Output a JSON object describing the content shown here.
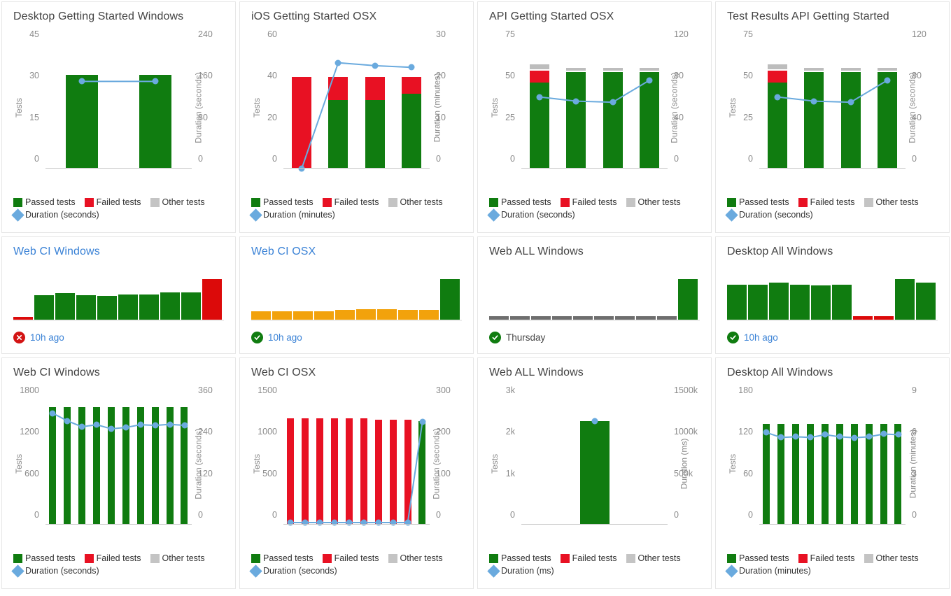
{
  "legend": {
    "passed_label": "Passed tests",
    "failed_label": "Failed tests",
    "other_label": "Other tests"
  },
  "colors": {
    "passed": "#107c10",
    "failed": "#e81123",
    "other": "#bdbdbd",
    "duration_line": "#6aaade",
    "link": "#3a82d6",
    "spark_other": "#f2a20c",
    "spark_skipped": "#6e6e6e"
  },
  "cards": [
    {
      "id": "desktop-getting-started-windows",
      "kind": "chart",
      "title": "Desktop Getting Started Windows",
      "title_is_link": false,
      "chart_data": {
        "type": "bar",
        "title": "Desktop Getting Started Windows",
        "ylabel": "Tests",
        "y2label": "Duration (seconds)",
        "yticks": [
          "0",
          "15",
          "30",
          "45"
        ],
        "y2ticks": [
          "0",
          "80",
          "160",
          "240"
        ],
        "ylim": [
          0,
          45
        ],
        "y2lim": [
          0,
          240
        ],
        "grid": false,
        "legend_position": "bottom",
        "duration_label": "Duration (seconds)",
        "categories": [
          "1",
          "2"
        ],
        "series": [
          {
            "name": "Passed tests",
            "values": [
              34,
              34
            ]
          },
          {
            "name": "Failed tests",
            "values": [
              0,
              0
            ]
          },
          {
            "name": "Other tests",
            "values": [
              0,
              0
            ]
          }
        ],
        "duration": [
          168,
          168
        ]
      }
    },
    {
      "id": "ios-getting-started-osx",
      "kind": "chart",
      "title": "iOS Getting Started OSX",
      "title_is_link": false,
      "chart_data": {
        "type": "bar",
        "title": "iOS Getting Started OSX",
        "ylabel": "Tests",
        "y2label": "Duration (minutes)",
        "yticks": [
          "0",
          "20",
          "40",
          "60"
        ],
        "y2ticks": [
          "0",
          "10",
          "20",
          "30"
        ],
        "ylim": [
          0,
          60
        ],
        "y2lim": [
          0,
          30
        ],
        "grid": false,
        "legend_position": "bottom",
        "duration_label": "Duration (minutes)",
        "categories": [
          "1",
          "2",
          "3",
          "4"
        ],
        "series": [
          {
            "name": "Passed tests",
            "values": [
              0,
              33,
              33,
              36
            ]
          },
          {
            "name": "Failed tests",
            "values": [
              44,
              11,
              11,
              8
            ]
          },
          {
            "name": "Other tests",
            "values": [
              0,
              0,
              0,
              0
            ]
          }
        ],
        "duration": [
          0,
          25.5,
          24.8,
          24.4
        ]
      }
    },
    {
      "id": "api-getting-started-osx",
      "kind": "chart",
      "title": "API Getting Started OSX",
      "title_is_link": false,
      "chart_data": {
        "type": "bar",
        "title": "API Getting Started OSX",
        "ylabel": "Tests",
        "y2label": "Duration (seconds)",
        "yticks": [
          "0",
          "25",
          "50",
          "75"
        ],
        "y2ticks": [
          "0",
          "40",
          "80",
          "120"
        ],
        "ylim": [
          0,
          75
        ],
        "y2lim": [
          0,
          120
        ],
        "grid": false,
        "legend_position": "bottom",
        "duration_label": "Duration (seconds)",
        "categories": [
          "1",
          "2",
          "3",
          "4"
        ],
        "series": [
          {
            "name": "Passed tests",
            "values": [
              52,
              58,
              58,
              58
            ]
          },
          {
            "name": "Failed tests",
            "values": [
              7,
              0,
              0,
              0
            ]
          },
          {
            "name": "Other tests",
            "values": [
              3,
              2,
              2,
              2
            ]
          }
        ],
        "duration": [
          69,
          65,
          64,
          85
        ]
      }
    },
    {
      "id": "test-results-api-getting-started",
      "kind": "chart",
      "title": "Test Results API Getting Started",
      "title_is_link": false,
      "chart_data": {
        "type": "bar",
        "title": "Test Results API Getting Started",
        "ylabel": "Tests",
        "y2label": "Duration (seconds)",
        "yticks": [
          "0",
          "25",
          "50",
          "75"
        ],
        "y2ticks": [
          "0",
          "40",
          "80",
          "120"
        ],
        "ylim": [
          0,
          75
        ],
        "y2lim": [
          0,
          120
        ],
        "grid": false,
        "legend_position": "bottom",
        "duration_label": "Duration (seconds)",
        "categories": [
          "1",
          "2",
          "3",
          "4"
        ],
        "series": [
          {
            "name": "Passed tests",
            "values": [
              52,
              58,
              58,
              58
            ]
          },
          {
            "name": "Failed tests",
            "values": [
              7,
              0,
              0,
              0
            ]
          },
          {
            "name": "Other tests",
            "values": [
              3,
              2,
              2,
              2
            ]
          }
        ],
        "duration": [
          69,
          65,
          64,
          85
        ]
      }
    },
    {
      "id": "web-ci-windows-spark",
      "kind": "spark",
      "title": "Web CI Windows",
      "title_is_link": true,
      "status_icon": "fail-icon",
      "status_text": "10h ago",
      "status_text_is_link": true,
      "chart_data": {
        "type": "bar",
        "title": "Web CI Windows",
        "grid": false,
        "categories": [
          "1",
          "2",
          "3",
          "4",
          "5",
          "6",
          "7",
          "8",
          "9",
          "10"
        ],
        "values": [
          8,
          62,
          66,
          62,
          60,
          64,
          63,
          69,
          69,
          100
        ],
        "bar_states": [
          "failed",
          "passed",
          "passed",
          "passed",
          "passed",
          "passed",
          "passed",
          "passed",
          "passed",
          "failed"
        ]
      }
    },
    {
      "id": "web-ci-osx-spark",
      "kind": "spark",
      "title": "Web CI OSX",
      "title_is_link": true,
      "status_icon": "pass-icon",
      "status_text": "10h ago",
      "status_text_is_link": true,
      "chart_data": {
        "type": "bar",
        "title": "Web CI OSX",
        "grid": false,
        "categories": [
          "1",
          "2",
          "3",
          "4",
          "5",
          "6",
          "7",
          "8",
          "9",
          "10"
        ],
        "values": [
          23,
          23,
          23,
          23,
          25,
          28,
          28,
          26,
          26,
          100
        ],
        "bar_states": [
          "other",
          "other",
          "other",
          "other",
          "other",
          "other",
          "other",
          "other",
          "other",
          "passed"
        ]
      }
    },
    {
      "id": "web-all-windows-spark",
      "kind": "spark",
      "title": "Web ALL Windows",
      "title_is_link": false,
      "status_icon": "pass-icon",
      "status_text": "Thursday",
      "status_text_is_link": false,
      "chart_data": {
        "type": "bar",
        "title": "Web ALL Windows",
        "grid": false,
        "categories": [
          "1",
          "2",
          "3",
          "4",
          "5",
          "6",
          "7",
          "8",
          "9",
          "10"
        ],
        "values": [
          11,
          11,
          11,
          11,
          11,
          11,
          11,
          11,
          11,
          100
        ],
        "bar_states": [
          "skipped",
          "skipped",
          "skipped",
          "skipped",
          "skipped",
          "skipped",
          "skipped",
          "skipped",
          "skipped",
          "passed"
        ]
      }
    },
    {
      "id": "desktop-all-windows-spark",
      "kind": "spark",
      "title": "Desktop All Windows",
      "title_is_link": false,
      "status_icon": "pass-icon",
      "status_text": "10h ago",
      "status_text_is_link": true,
      "chart_data": {
        "type": "bar",
        "title": "Desktop All Windows",
        "grid": false,
        "categories": [
          "1",
          "2",
          "3",
          "4",
          "5",
          "6",
          "7",
          "8",
          "9",
          "10"
        ],
        "values": [
          88,
          88,
          93,
          88,
          86,
          88,
          10,
          10,
          100,
          93
        ],
        "bar_states": [
          "passed",
          "passed",
          "passed",
          "passed",
          "passed",
          "passed",
          "failed",
          "failed",
          "passed",
          "passed"
        ]
      }
    },
    {
      "id": "web-ci-windows-chart",
      "kind": "chart",
      "title": "Web CI Windows",
      "title_is_link": false,
      "chart_data": {
        "type": "bar",
        "title": "Web CI Windows",
        "ylabel": "Tests",
        "y2label": "Duration (seconds)",
        "yticks": [
          "0",
          "600",
          "1200",
          "1800"
        ],
        "y2ticks": [
          "0",
          "120",
          "240",
          "360"
        ],
        "ylim": [
          0,
          1800
        ],
        "y2lim": [
          0,
          360
        ],
        "grid": false,
        "legend_position": "bottom",
        "duration_label": "Duration (seconds)",
        "categories": [
          "1",
          "2",
          "3",
          "4",
          "5",
          "6",
          "7",
          "8",
          "9",
          "10"
        ],
        "series": [
          {
            "name": "Passed tests",
            "values": [
              1700,
              1700,
              1700,
              1700,
              1700,
              1700,
              1700,
              1700,
              1700,
              1700
            ]
          },
          {
            "name": "Failed tests",
            "values": [
              0,
              0,
              0,
              0,
              0,
              0,
              0,
              0,
              0,
              0
            ]
          },
          {
            "name": "Other tests",
            "values": [
              0,
              0,
              0,
              0,
              0,
              0,
              0,
              0,
              0,
              0
            ]
          }
        ],
        "duration": [
          322,
          300,
          283,
          289,
          277,
          281,
          289,
          287,
          290,
          287
        ]
      }
    },
    {
      "id": "web-ci-osx-chart",
      "kind": "chart",
      "title": "Web CI OSX",
      "title_is_link": false,
      "chart_data": {
        "type": "bar",
        "title": "Web CI OSX",
        "ylabel": "Tests",
        "y2label": "Duration (seconds)",
        "yticks": [
          "0",
          "500",
          "1000",
          "1500"
        ],
        "y2ticks": [
          "0",
          "100",
          "200",
          "300"
        ],
        "ylim": [
          0,
          1500
        ],
        "y2lim": [
          0,
          300
        ],
        "grid": false,
        "legend_position": "bottom",
        "duration_label": "Duration (seconds)",
        "categories": [
          "1",
          "2",
          "3",
          "4",
          "5",
          "6",
          "7",
          "8",
          "9",
          "10"
        ],
        "series": [
          {
            "name": "Passed tests",
            "values": [
              0,
              0,
              0,
              0,
              0,
              0,
              0,
              0,
              0,
              1250
            ]
          },
          {
            "name": "Failed tests",
            "values": [
              1280,
              1280,
              1280,
              1280,
              1280,
              1280,
              1265,
              1265,
              1265,
              0
            ]
          },
          {
            "name": "Other tests",
            "values": [
              0,
              0,
              0,
              0,
              0,
              0,
              0,
              0,
              0,
              0
            ]
          }
        ],
        "duration": [
          5,
          5,
          5,
          5,
          5,
          5,
          5,
          5,
          5,
          247
        ]
      }
    },
    {
      "id": "web-all-windows-chart",
      "kind": "chart",
      "title": "Web ALL Windows",
      "title_is_link": false,
      "chart_data": {
        "type": "bar",
        "title": "Web ALL Windows",
        "ylabel": "Tests",
        "y2label": "Duration (ms)",
        "yticks": [
          "0",
          "1k",
          "2k",
          "3k"
        ],
        "y2ticks": [
          "0",
          "500k",
          "1000k",
          "1500k"
        ],
        "ylim": [
          0,
          3000
        ],
        "y2lim": [
          0,
          1500000
        ],
        "grid": false,
        "legend_position": "bottom",
        "duration_label": "Duration (ms)",
        "categories": [
          "1"
        ],
        "series": [
          {
            "name": "Passed tests",
            "values": [
              2500
            ]
          },
          {
            "name": "Failed tests",
            "values": [
              0
            ]
          },
          {
            "name": "Other tests",
            "values": [
              0
            ]
          }
        ],
        "duration": [
          1250000
        ]
      }
    },
    {
      "id": "desktop-all-windows-chart",
      "kind": "chart",
      "title": "Desktop All Windows",
      "title_is_link": false,
      "chart_data": {
        "type": "bar",
        "title": "Desktop All Windows",
        "ylabel": "Tests",
        "y2label": "Duration (minutes)",
        "yticks": [
          "0",
          "60",
          "120",
          "180"
        ],
        "y2ticks": [
          "0",
          "3",
          "6",
          "9"
        ],
        "ylim": [
          0,
          180
        ],
        "y2lim": [
          0,
          9
        ],
        "grid": false,
        "legend_position": "bottom",
        "duration_label": "Duration (minutes)",
        "categories": [
          "1",
          "2",
          "3",
          "4",
          "5",
          "6",
          "7",
          "8",
          "9",
          "10"
        ],
        "series": [
          {
            "name": "Passed tests",
            "values": [
              146,
              146,
              146,
              146,
              146,
              146,
              146,
              146,
              146,
              146
            ]
          },
          {
            "name": "Failed tests",
            "values": [
              0,
              0,
              0,
              0,
              0,
              0,
              0,
              0,
              0,
              0
            ]
          },
          {
            "name": "Other tests",
            "values": [
              0,
              0,
              0,
              0,
              0,
              0,
              0,
              0,
              0,
              0
            ]
          }
        ],
        "duration": [
          6.65,
          6.3,
          6.35,
          6.3,
          6.5,
          6.35,
          6.28,
          6.35,
          6.55,
          6.5
        ]
      }
    }
  ]
}
